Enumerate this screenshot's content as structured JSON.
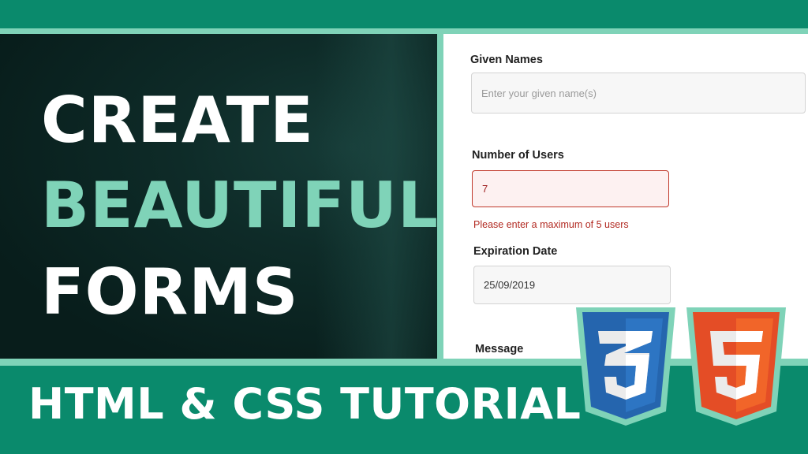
{
  "headline": {
    "line1": "CREATE",
    "line2": "BEAUTIFUL",
    "line3": "FORMS"
  },
  "footer": {
    "title": "HTML & CSS TUTORIAL"
  },
  "form": {
    "given_names": {
      "label": "Given Names",
      "placeholder": "Enter your given name(s)"
    },
    "number_of_users": {
      "label": "Number of Users",
      "value": "7",
      "error": "Please enter a maximum of 5 users"
    },
    "expiration_date": {
      "label": "Expiration Date",
      "value": "25/09/2019"
    },
    "message": {
      "label": "Message"
    }
  },
  "icons": {
    "css3": "css3-logo-icon",
    "html5": "html5-logo-icon"
  },
  "colors": {
    "brand_green": "#0a8a6c",
    "accent_mint": "#7fd3b8",
    "dark_panel": "#0b2422",
    "error_red": "#b22a22",
    "css_blue": "#2565ae",
    "html_orange": "#e44d26"
  }
}
